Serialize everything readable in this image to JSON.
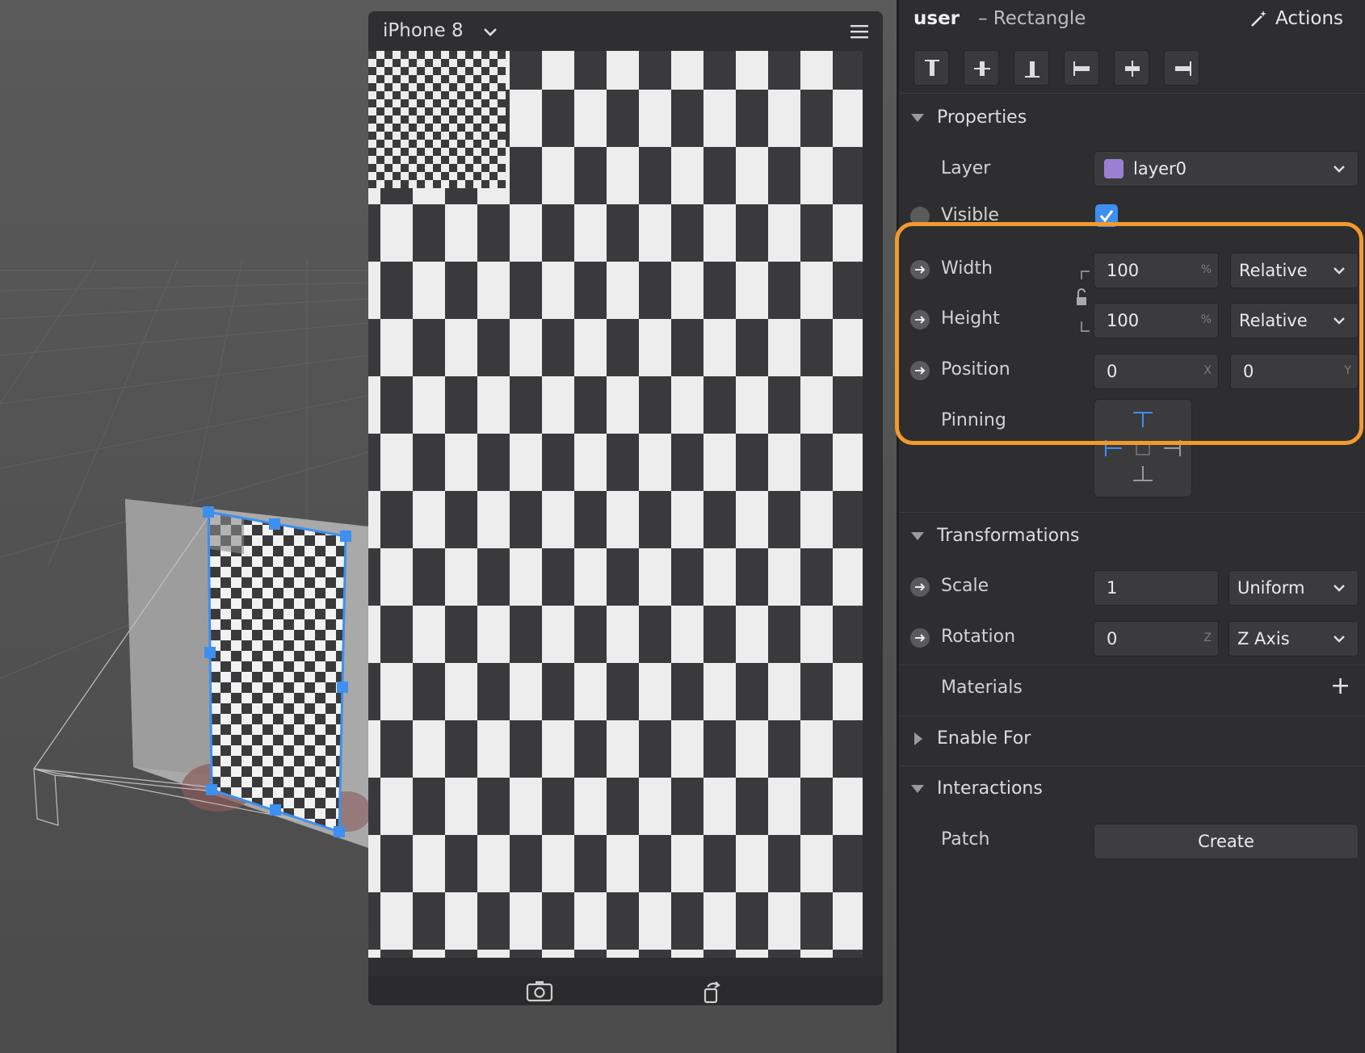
{
  "simulator": {
    "device": "iPhone 8",
    "footer_icons": [
      "camera-switch-icon",
      "rotate-icon"
    ]
  },
  "inspector": {
    "selection_name": "user",
    "selection_type": "– Rectangle",
    "actions_label": "Actions",
    "align_buttons": [
      "align-top-icon",
      "align-vcenter-icon",
      "align-bottom-icon",
      "align-left-icon",
      "align-hcenter-icon",
      "align-right-icon"
    ],
    "properties": {
      "title": "Properties",
      "layer_label": "Layer",
      "layer_value": "layer0",
      "layer_color": "#9b7fd4",
      "visible_label": "Visible",
      "visible_checked": true,
      "width_label": "Width",
      "width_value": "100",
      "width_unit": "%",
      "width_mode": "Relative",
      "height_label": "Height",
      "height_value": "100",
      "height_unit": "%",
      "height_mode": "Relative",
      "position_label": "Position",
      "position_x": "0",
      "position_x_unit": "X",
      "position_y": "0",
      "position_y_unit": "Y",
      "pinning_label": "Pinning"
    },
    "transformations": {
      "title": "Transformations",
      "scale_label": "Scale",
      "scale_value": "1",
      "scale_mode": "Uniform",
      "rotation_label": "Rotation",
      "rotation_value": "0",
      "rotation_unit": "Z",
      "rotation_axis": "Z Axis"
    },
    "materials": {
      "title": "Materials",
      "add_label": "+"
    },
    "enable_for": {
      "title": "Enable For"
    },
    "interactions": {
      "title": "Interactions",
      "patch_label": "Patch",
      "create_label": "Create"
    }
  },
  "colors": {
    "accent": "#3d8ff0",
    "highlight": "#f29a2e",
    "panel_bg": "#2e2e30",
    "checker_dark": "#3a3a3c",
    "checker_light": "#ededed"
  }
}
